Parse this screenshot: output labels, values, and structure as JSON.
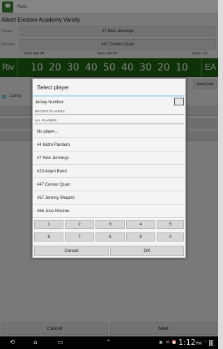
{
  "app": {
    "title": "Pass"
  },
  "team_name": "Albert Einstein Academy Varsity",
  "rows": {
    "passer_label": "Passer",
    "passer_value": "#7 Nick Jennings",
    "receiver_label": "Receiver",
    "receiver_value": "#47 Connor Quan"
  },
  "stats": {
    "start": "Start: EA 34",
    "end": "End: EA 34",
    "gain": "Gain: +0"
  },
  "field": {
    "left_end": "Riv",
    "right_end": "EA",
    "numbers": [
      "10",
      "20",
      "30",
      "40",
      "50",
      "40",
      "30",
      "20",
      "10"
    ]
  },
  "swap_ends": "Swap Ends",
  "comp_label": "Comp",
  "bottom": {
    "cancel": "Cancel",
    "next": "Next"
  },
  "dialog": {
    "title": "Select player",
    "jersey_label": "Jersey Number:",
    "jersey_value": "",
    "recent_header": "RECENT PLAYERS",
    "all_header": "ALL PLAYERS",
    "players": [
      "No player...",
      "#4 Isidro Panduro",
      "#7 Nick Jennings",
      "#23 Adam Bond",
      "#47 Connor Quan",
      "#57 Jeremy Shapiro",
      "#66 Jose Moreno"
    ],
    "keys": [
      "1",
      "2",
      "3",
      "4",
      "5",
      "6",
      "7",
      "8",
      "9",
      "0"
    ],
    "cancel": "Cancel",
    "ok": "OK"
  },
  "system": {
    "time": "1:12",
    "ampm": "PM"
  },
  "colors": {
    "accent": "#33b5e5",
    "field": "#1d5e10"
  }
}
